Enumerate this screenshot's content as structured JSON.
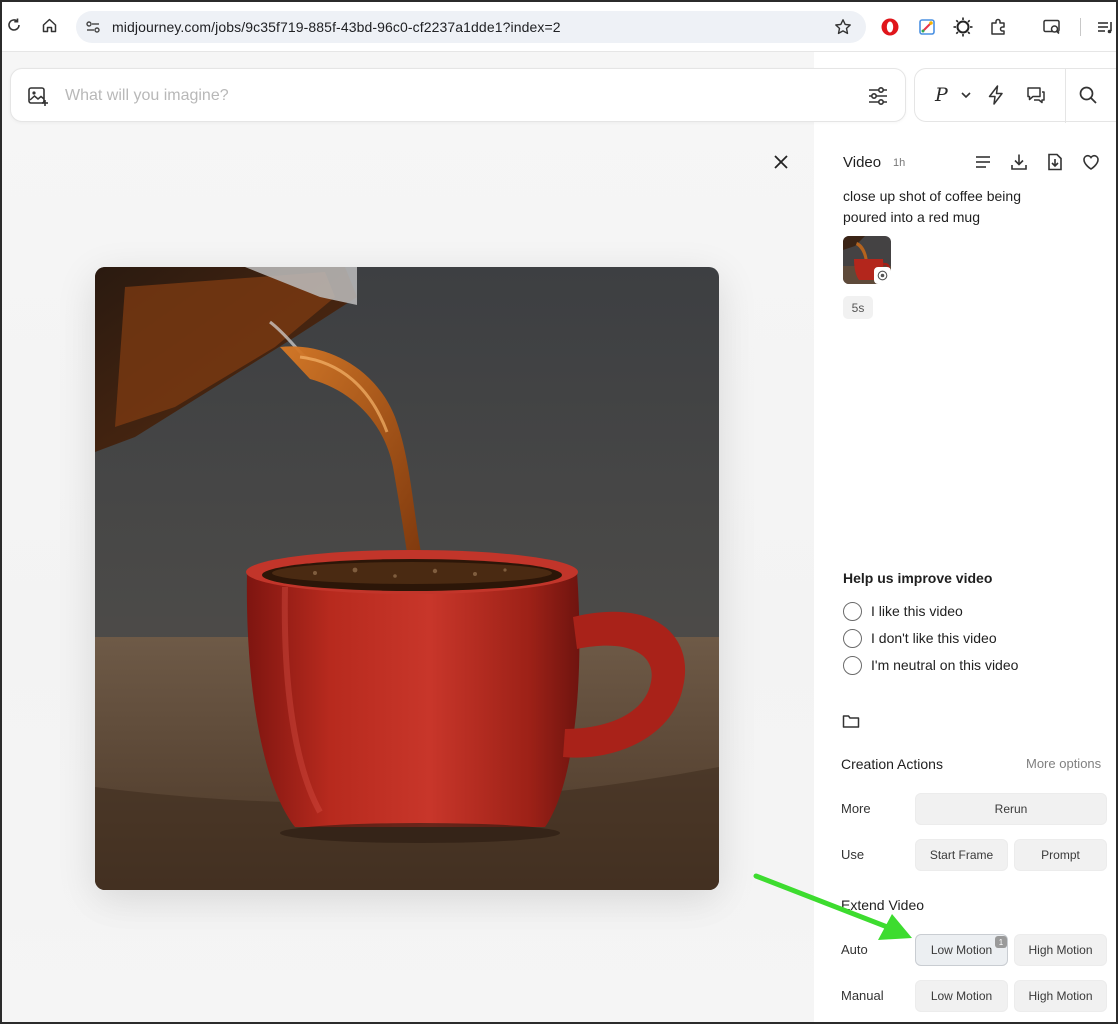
{
  "browser": {
    "url": "midjourney.com/jobs/9c35f719-885f-43bd-96c0-cf2237a1dde1?index=2"
  },
  "prompt_bar": {
    "placeholder": "What will you imagine?",
    "personalize_letter": "P"
  },
  "detail": {
    "title": "Video",
    "age": "1h",
    "prompt_text": "close up shot of coffee being poured into a red mug",
    "duration_chip": "5s"
  },
  "feedback": {
    "title": "Help us improve video",
    "options": [
      "I like this video",
      "I don't like this video",
      "I'm neutral on this video"
    ]
  },
  "creation_actions": {
    "title": "Creation Actions",
    "more_options": "More options",
    "more_label": "More",
    "rerun": "Rerun",
    "use_label": "Use",
    "start_frame": "Start Frame",
    "prompt": "Prompt"
  },
  "extend_video": {
    "title": "Extend Video",
    "auto_label": "Auto",
    "manual_label": "Manual",
    "low_motion": "Low Motion",
    "high_motion": "High Motion",
    "low_motion_badge": "1"
  },
  "colors": {
    "annotation_arrow": "#3ddc2f",
    "mug_red": "#b5271d",
    "coffee": "#8a3c0a"
  },
  "icons": [
    "reload-icon",
    "home-icon",
    "site-settings-icon",
    "star-icon",
    "opera-icon",
    "color-picker-icon",
    "sun-icon",
    "puzzle-icon",
    "screen-search-icon",
    "playlist-icon",
    "image-add-icon",
    "sliders-icon",
    "chevron-down-icon",
    "bolt-icon",
    "chat-icon",
    "search-icon",
    "close-icon",
    "list-icon",
    "download-icon",
    "save-icon",
    "heart-icon",
    "folder-icon"
  ]
}
